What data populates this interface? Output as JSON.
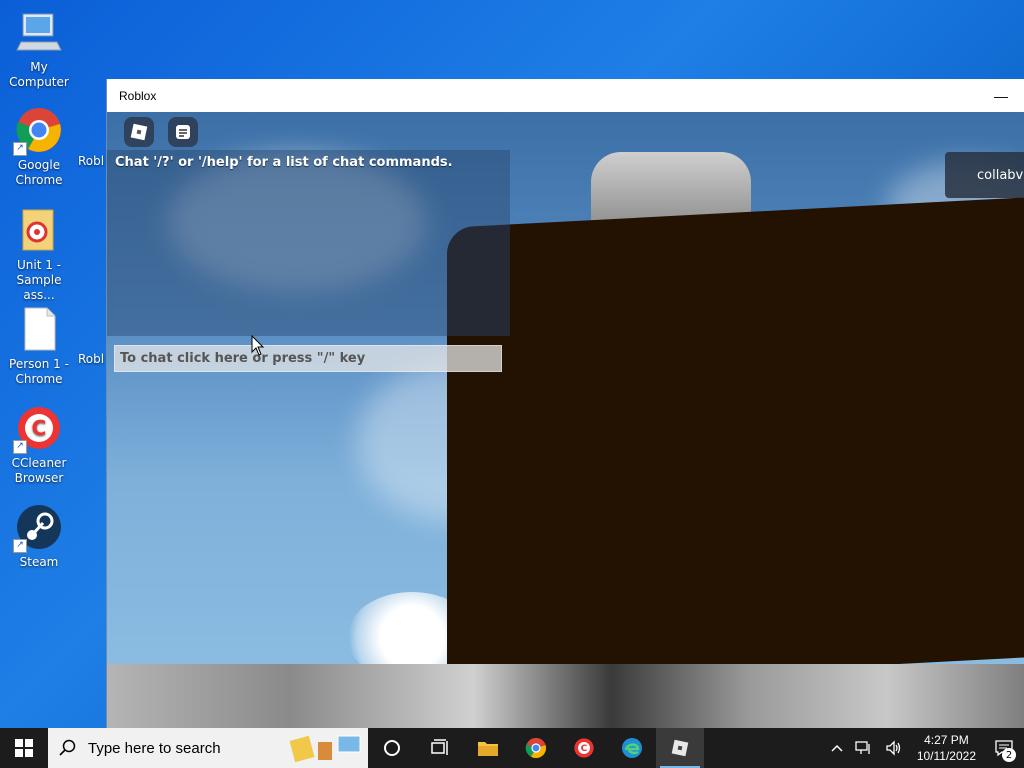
{
  "desktop": {
    "icons": [
      {
        "label": "My Computer",
        "icon": "computer-icon"
      },
      {
        "label": "Google Chrome",
        "icon": "chrome-icon"
      },
      {
        "label": "Unit 1 - Sample ass...",
        "icon": "folder-document-icon"
      },
      {
        "label": "Person 1 - Chrome",
        "icon": "blank-document-icon"
      },
      {
        "label": "CCleaner Browser",
        "icon": "ccleaner-icon"
      },
      {
        "label": "Steam",
        "icon": "steam-icon"
      },
      {
        "label": "Robl",
        "icon": "roblox-icon"
      },
      {
        "label": "Robl",
        "icon": "roblox-icon"
      }
    ]
  },
  "window": {
    "title": "Roblox",
    "minimize_glyph": "—"
  },
  "game": {
    "chat_message": "Chat '/?' or '/help' for a list of chat commands.",
    "chat_placeholder": "To chat click here or press \"/\" key",
    "collab_label": "collabv"
  },
  "taskbar": {
    "search_placeholder": "Type here to search",
    "time": "4:27 PM",
    "date": "10/11/2022",
    "notification_count": "2"
  },
  "colors": {
    "desktop_blue": "#0b5ed7",
    "taskbar": "#1c1c1c",
    "active_indicator": "#76b9ed"
  }
}
